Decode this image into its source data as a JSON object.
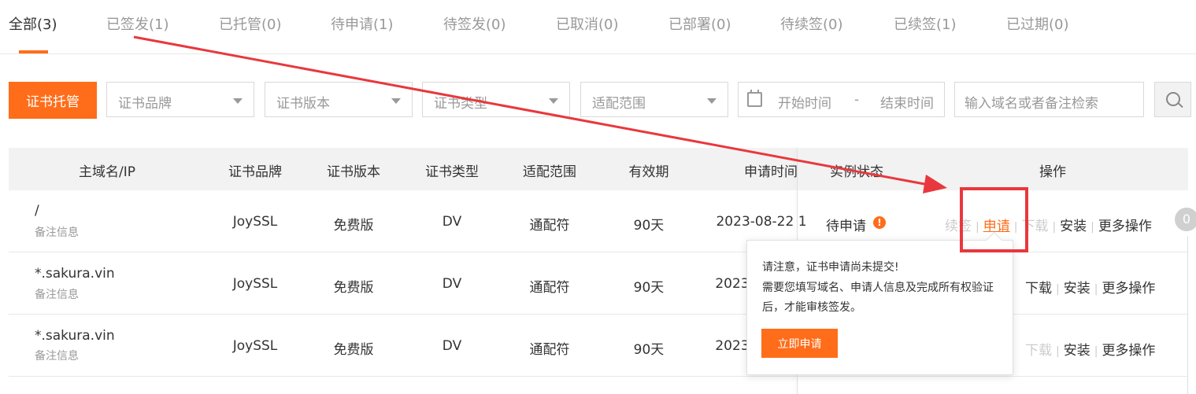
{
  "tabs": [
    {
      "label": "全部(3)",
      "active": true
    },
    {
      "label": "已签发(1)"
    },
    {
      "label": "已托管(0)"
    },
    {
      "label": "待申请(1)"
    },
    {
      "label": "待签发(0)"
    },
    {
      "label": "已取消(0)"
    },
    {
      "label": "已部署(0)"
    },
    {
      "label": "待续签(0)"
    },
    {
      "label": "已续签(1)"
    },
    {
      "label": "已过期(0)"
    }
  ],
  "toolbar": {
    "primary_button": "证书托管",
    "filters": [
      "证书品牌",
      "证书版本",
      "证书类型",
      "适配范围"
    ],
    "date_start": "开始时间",
    "date_sep": "-",
    "date_end": "结束时间",
    "search_placeholder": "输入域名或者备注检索"
  },
  "table": {
    "columns": [
      "主域名/IP",
      "证书品牌",
      "证书版本",
      "证书类型",
      "适配范围",
      "有效期",
      "申请时间",
      "实例状态",
      "操作"
    ],
    "rows": [
      {
        "domain": "/",
        "remark": "备注信息",
        "brand": "JoySSL",
        "edition": "免费版",
        "type": "DV",
        "scope": "通配符",
        "validity": "90天",
        "applied": "2023-08-22 1",
        "status": "待申请"
      },
      {
        "domain": "*.sakura.vin",
        "remark": "备注信息",
        "brand": "JoySSL",
        "edition": "免费版",
        "type": "DV",
        "scope": "通配符",
        "validity": "90天",
        "applied": "2023"
      },
      {
        "domain": "*.sakura.vin",
        "remark": "备注信息",
        "brand": "JoySSL",
        "edition": "免费版",
        "type": "DV",
        "scope": "通配符",
        "validity": "90天",
        "applied": "2023"
      }
    ],
    "ops": {
      "renew": "续签",
      "apply": "申请",
      "download": "下载",
      "install": "安装",
      "more": "更多操作",
      "sep": "|"
    },
    "warn_glyph": "!",
    "side_badge": "0"
  },
  "popover": {
    "line1": "请注意，证书申请尚未提交!",
    "line2": "需要您填写域名、申请人信息及完成所有权验证后，才能审核签发。",
    "button": "立即申请"
  },
  "colors": {
    "accent": "#ff6d1a",
    "annotation": "#e8383d"
  }
}
